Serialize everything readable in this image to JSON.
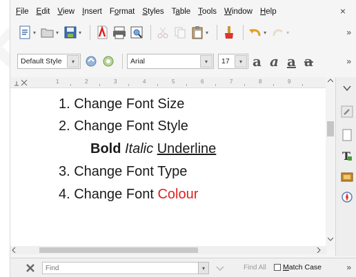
{
  "watermark": "Publish",
  "menubar": {
    "items": [
      {
        "label": "File",
        "u": "F",
        "rest": "ile"
      },
      {
        "label": "Edit",
        "u": "E",
        "rest": "dit"
      },
      {
        "label": "View",
        "u": "V",
        "rest": "iew"
      },
      {
        "label": "Insert",
        "u": "I",
        "rest": "nsert"
      },
      {
        "label": "Format",
        "u": "o",
        "pre": "F",
        "rest": "rmat"
      },
      {
        "label": "Styles",
        "u": "S",
        "rest": "tyles"
      },
      {
        "label": "Table",
        "u": "a",
        "pre": "T",
        "rest": "ble"
      },
      {
        "label": "Tools",
        "u": "T",
        "rest": "ools"
      },
      {
        "label": "Window",
        "u": "W",
        "rest": "indow"
      },
      {
        "label": "Help",
        "u": "H",
        "rest": "elp"
      }
    ],
    "close": "×"
  },
  "formatting": {
    "paragraph_style": "Default Style",
    "font_name": "Arial",
    "font_size": "17",
    "style_letters": [
      "a",
      "a",
      "a",
      "a"
    ]
  },
  "overflow_chevron": "»",
  "ruler": {
    "numbers": [
      "1",
      "2",
      "3",
      "4",
      "5",
      "6",
      "7",
      "8",
      "9"
    ]
  },
  "document": {
    "line1": "1. Change Font Size",
    "line2": "2. Change Font Style",
    "bold": "Bold",
    "italic": "Italic",
    "underline": "Underline",
    "line3": "3. Change Font Type",
    "line4_prefix": "4. Change Font ",
    "line4_colored": "Colour"
  },
  "findbar": {
    "placeholder": "Find",
    "find_all": "Find All",
    "match_case_u": "M",
    "match_case_rest": "atch Case"
  },
  "colors": {
    "accent_red": "#e02020"
  }
}
